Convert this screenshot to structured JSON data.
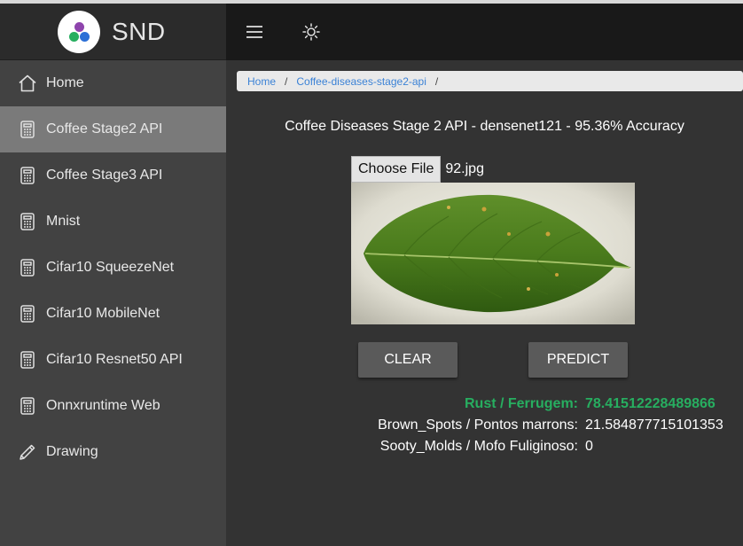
{
  "app": {
    "brand": "SND",
    "colors": {
      "accent": "#27ae60",
      "link": "#3b82d6",
      "sidebar": "#424242",
      "header": "#191919",
      "active": "#7a7a7a"
    }
  },
  "header": {
    "menu_icon": "hamburger-menu-icon",
    "theme_icon": "sun-icon"
  },
  "sidebar": {
    "items": [
      {
        "label": "Home",
        "icon": "home-icon",
        "active": false
      },
      {
        "label": "Coffee Stage2 API",
        "icon": "calculator-icon",
        "active": true
      },
      {
        "label": "Coffee Stage3 API",
        "icon": "calculator-icon",
        "active": false
      },
      {
        "label": "Mnist",
        "icon": "calculator-icon",
        "active": false
      },
      {
        "label": "Cifar10 SqueezeNet",
        "icon": "calculator-icon",
        "active": false
      },
      {
        "label": "Cifar10 MobileNet",
        "icon": "calculator-icon",
        "active": false
      },
      {
        "label": "Cifar10 Resnet50 API",
        "icon": "calculator-icon",
        "active": false
      },
      {
        "label": "Onnxruntime Web",
        "icon": "calculator-icon",
        "active": false
      },
      {
        "label": "Drawing",
        "icon": "pencil-icon",
        "active": false
      }
    ]
  },
  "breadcrumb": {
    "items": [
      "Home",
      "Coffee-diseases-stage2-api"
    ],
    "separator": "/"
  },
  "main": {
    "title": "Coffee Diseases Stage 2 API - densenet121 - 95.36% Accuracy",
    "file_input": {
      "button_label": "Choose File",
      "file_name": "92.jpg"
    },
    "buttons": {
      "clear": "CLEAR",
      "predict": "PREDICT"
    },
    "results": [
      {
        "label": "Rust / Ferrugem:",
        "value": "78.41512228489866",
        "top": true
      },
      {
        "label": "Brown_Spots / Pontos marrons:",
        "value": "21.584877715101353",
        "top": false
      },
      {
        "label": "Sooty_Molds / Mofo Fuliginoso:",
        "value": "0",
        "top": false
      }
    ]
  }
}
